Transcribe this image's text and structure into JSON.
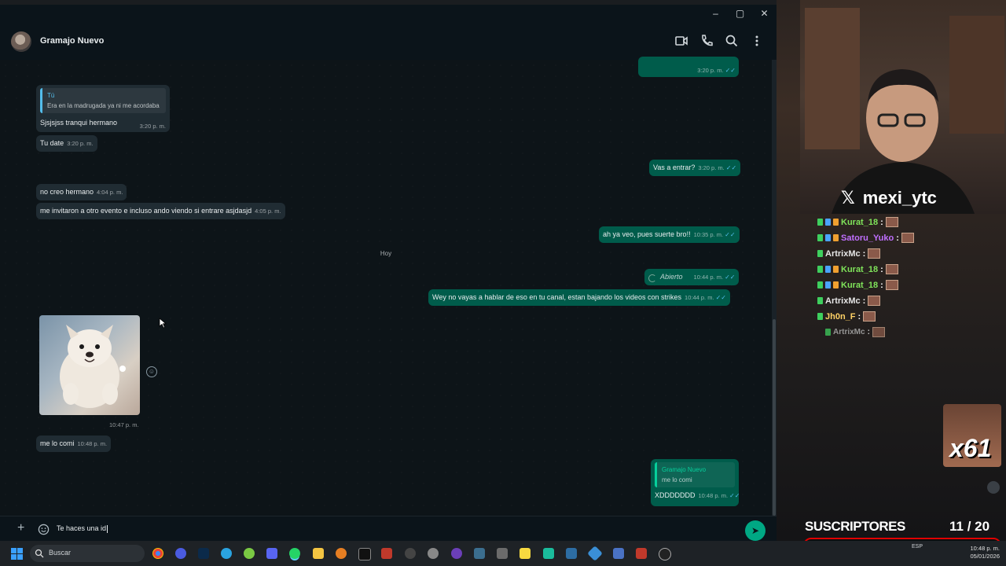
{
  "window": {
    "minimize": "–",
    "maximize": "▢",
    "close": "✕"
  },
  "chat_header": {
    "name": "Gramajo Nuevo"
  },
  "messages": {
    "m0_time": "3:20 p. m.",
    "m1_quote_name": "Tú",
    "m1_quote_text": "Era en la madrugada ya ni me acordaba",
    "m1_text": "Sjsjsjss tranqui hermano",
    "m1_time": "3:20 p. m.",
    "m2_text": "Tu date",
    "m2_time": "3:20 p. m.",
    "m3_text": "Vas a entrar?",
    "m3_time": "3:20 p. m.",
    "m4_text": "no creo hermano",
    "m4_time": "4:04 p. m.",
    "m5_text": "me invitaron a otro evento e incluso ando viendo si entrare asjdasjd",
    "m5_time": "4:05 p. m.",
    "m6_text": "ah ya veo, pues suerte bro!!",
    "m6_time": "10:35 p. m.",
    "date_divider": "Hoy",
    "m7_text": "Abierto",
    "m7_time": "10:44 p. m.",
    "m8_text": "Wey no vayas a hablar de eso en tu canal, estan bajando los videos con strikes",
    "m8_time": "10:44 p. m.",
    "m9_time": "10:47 p. m.",
    "m10_text": "me lo comi",
    "m10_time": "10:48 p. m.",
    "m11_quote_name": "Gramajo Nuevo",
    "m11_quote_text": "me lo comi",
    "m11_text": "XDDDDDDD",
    "m11_time": "10:48 p. m."
  },
  "composer": {
    "value": "Te haces una id",
    "add": "+",
    "send": "➤"
  },
  "taskbar": {
    "search_label": "Buscar",
    "clock_time": "10:48 p. m.",
    "clock_date": "05/01/2026",
    "lang": "ESP"
  },
  "stream": {
    "handle": "mexi_ytc",
    "chat": [
      {
        "user": "Kurat_18",
        "sep": ":",
        "color": "#7fe35a"
      },
      {
        "user": "Satoru_Yuko",
        "sep": ":",
        "color": "#c06fff"
      },
      {
        "user": "ArtrixMc",
        "sep": ":",
        "color": "#e6e6e6"
      },
      {
        "user": "Kurat_18",
        "sep": ":",
        "color": "#7fe35a"
      },
      {
        "user": "Kurat_18",
        "sep": ":",
        "color": "#7fe35a"
      },
      {
        "user": "ArtrixMc",
        "sep": ":",
        "color": "#e6e6e6"
      },
      {
        "user": "Jh0n_F",
        "sep": ":",
        "color": "#ffd166"
      },
      {
        "user": "ArtrixMc",
        "sep": ":",
        "color": "#bdbdbd"
      }
    ],
    "combo": "x61",
    "subs_label": "SUSCRIPTORES",
    "subs_count": "11 / 20",
    "subs_progress": 0.55
  },
  "colors": {
    "incoming": "#202c33",
    "outgoing": "#005c4b",
    "read_ticks": "#53bdeb",
    "send_button": "#00a884"
  }
}
